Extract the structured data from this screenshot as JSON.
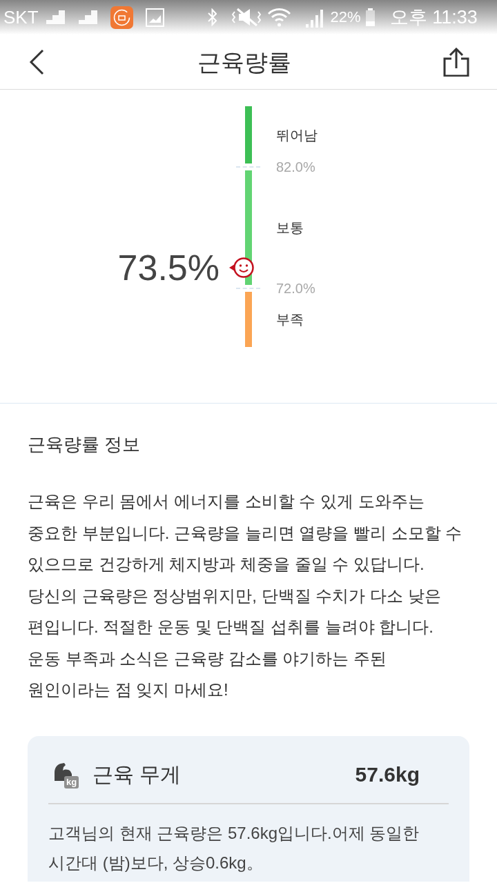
{
  "status_bar": {
    "carrier": "SKT",
    "battery": "22%",
    "time": "오후 11:33"
  },
  "header": {
    "title": "근육량률"
  },
  "gauge": {
    "value": "73.5%",
    "level": 0.33,
    "segments": [
      {
        "label": "뛰어남",
        "color": "#3dbf55"
      },
      {
        "label": "보통",
        "color": "#62d473"
      },
      {
        "label": "부족",
        "color": "#fba554"
      }
    ],
    "thresholds": [
      "82.0%",
      "72.0%"
    ]
  },
  "info": {
    "title": "근육량률 정보",
    "body": "근육은 우리 몸에서 에너지를 소비할 수 있게 도와주는 중요한 부분입니다. 근육량을 늘리면 열량을 빨리 소모할 수 있으므로 건강하게 체지방과 체중을 줄일 수 있답니다. 당신의 근육량은 정상범위지만, 단백질 수치가 다소 낮은 편입니다. 적절한 운동 및 단백질 섭취를 늘려야 합니다. 운동 부족과 소식은 근육량 감소를 야기하는 주된 원인이라는 점 잊지 마세요!"
  },
  "card": {
    "title": "근육 무게",
    "value": "57.6kg",
    "icon_badge": "kg",
    "description": "고객님의 현재 근육량은 57.6kg입니다.어제 동일한 시간대 (밤)보다, 상승0.6kg。"
  }
}
